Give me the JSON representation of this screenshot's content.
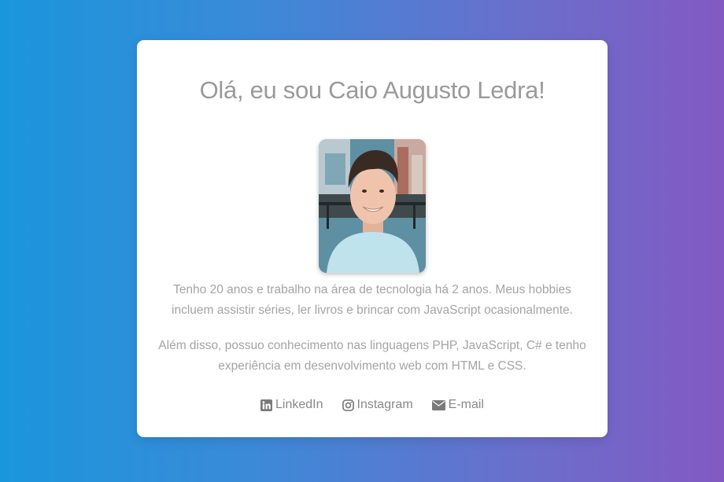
{
  "profile": {
    "heading": "Olá, eu sou Caio Augusto Ledra!",
    "photo_icon": "profile-photo",
    "bio_paragraph_1": "Tenho 20 anos e trabalho na área de tecnologia há 2 anos. Meus hobbies incluem assistir séries, ler livros e brincar com JavaScript ocasionalmente.",
    "bio_paragraph_2": "Além disso, possuo conhecimento nas linguagens PHP, JavaScript, C# e tenho experiência em desenvolvimento web com HTML e CSS."
  },
  "social_links": [
    {
      "label": "LinkedIn",
      "icon": "linkedin-icon"
    },
    {
      "label": "Instagram",
      "icon": "instagram-icon"
    },
    {
      "label": "E-mail",
      "icon": "envelope-icon"
    }
  ],
  "colors": {
    "gradient_start": "#1a96dc",
    "gradient_end": "#8259c2",
    "card_background": "#ffffff",
    "text_muted": "#a4a4a4",
    "heading": "#9a9a9a"
  }
}
